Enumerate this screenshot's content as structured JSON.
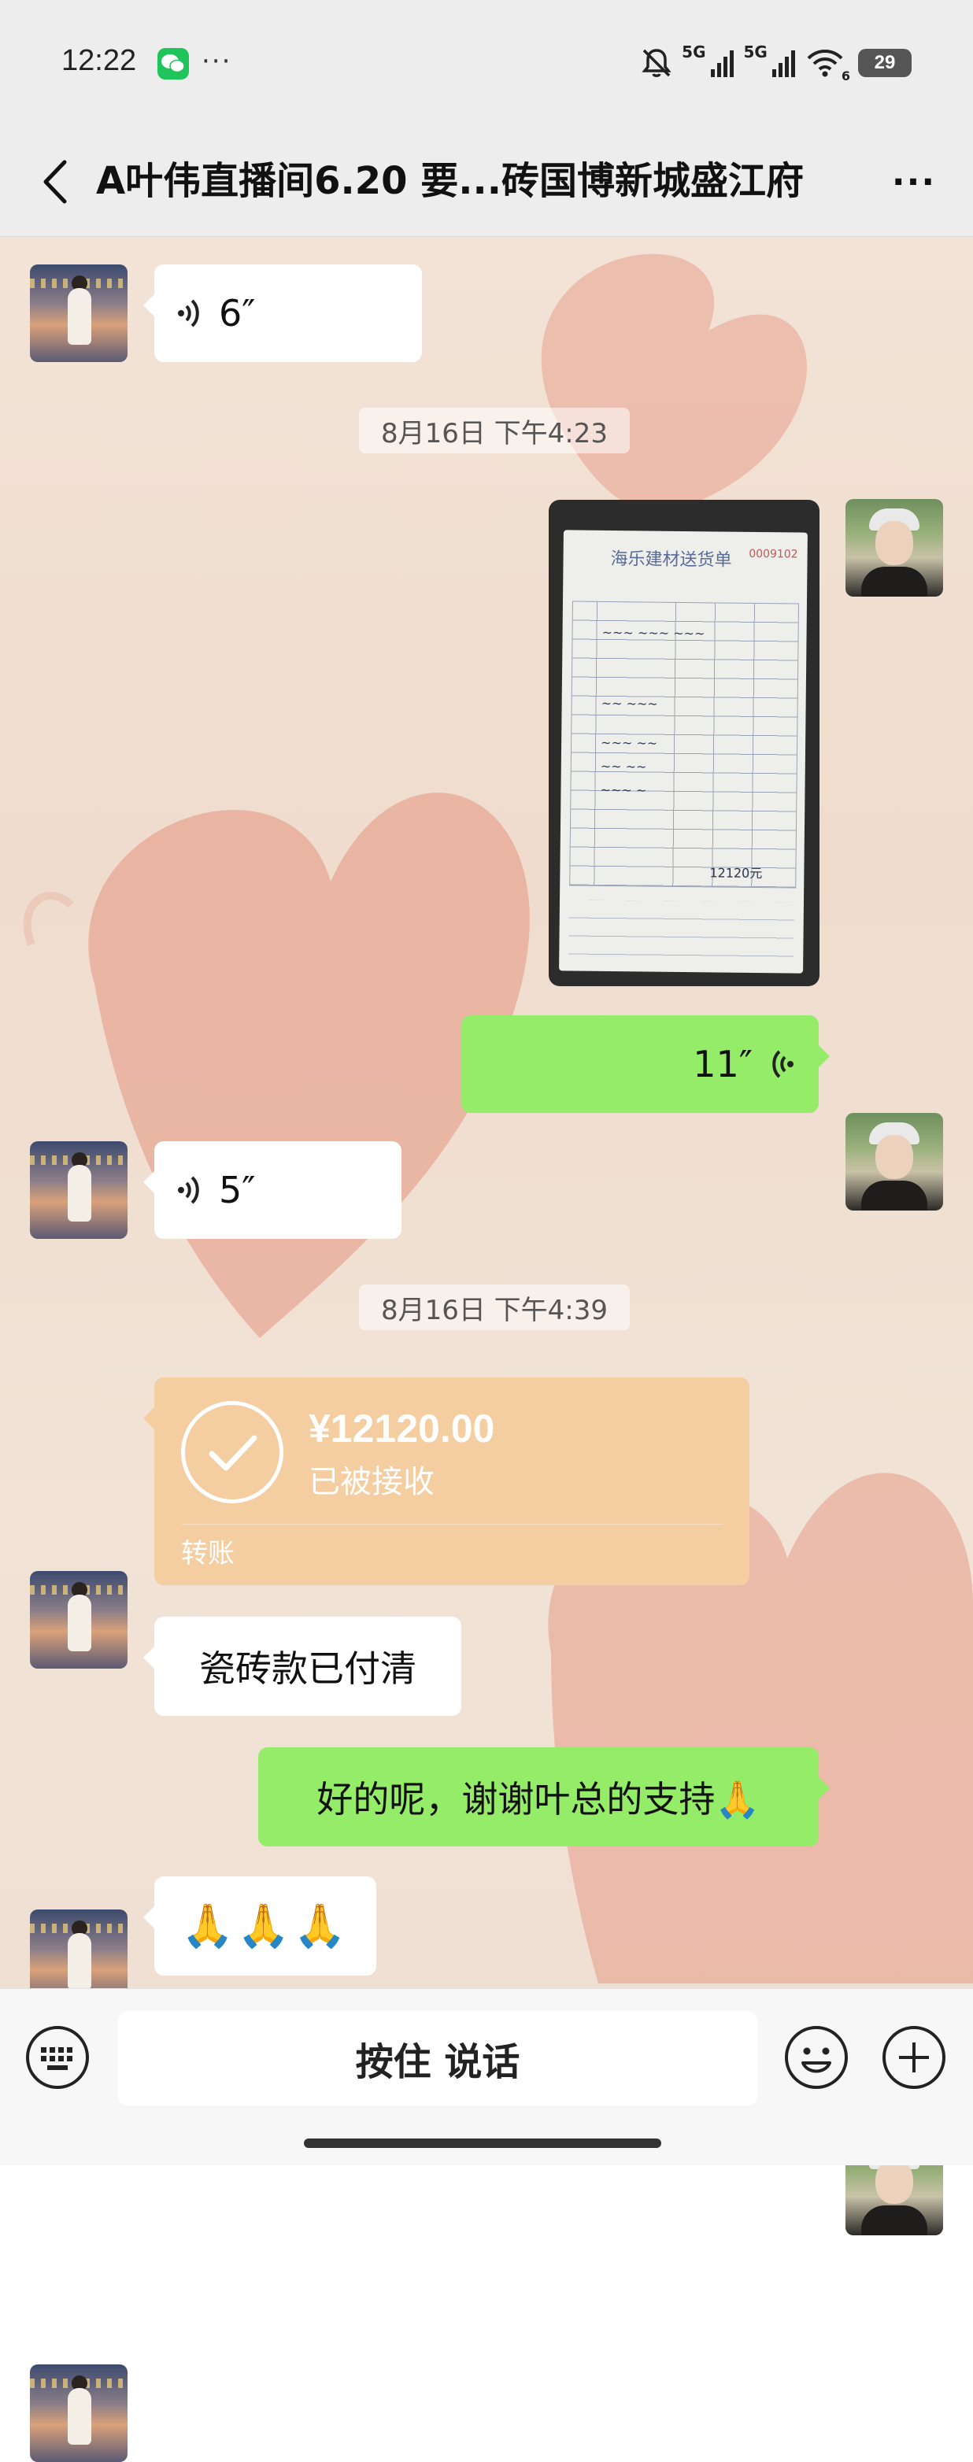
{
  "status_bar": {
    "time": "12:22",
    "more": "···",
    "signal_label_1": "5G",
    "signal_label_2": "5G",
    "wifi_sub": "6",
    "battery": "29"
  },
  "header": {
    "title": "A叶伟直播间6.20 要...砖国博新城盛江府",
    "more": "···"
  },
  "timestamps": {
    "t1": "8月16日 下午4:23",
    "t2": "8月16日 下午4:39"
  },
  "messages": {
    "voice_1": "6″",
    "voice_2": "11″",
    "voice_3": "5″",
    "text_paid": "瓷砖款已付清",
    "text_thanks": "好的呢，谢谢叶总的支持🙏",
    "text_emoji": "🙏🙏🙏"
  },
  "receipt": {
    "heading": "海乐建材送货单",
    "number": "0009102",
    "total": "12120元"
  },
  "transfer": {
    "amount": "¥12120.00",
    "status": "已被接收",
    "kind": "转账",
    "color": "#f4cda0"
  },
  "input_bar": {
    "talk_label": "按住 说话"
  },
  "colors": {
    "bubble_green": "#95ec69",
    "bubble_white": "#ffffff",
    "header_bg": "#ededed"
  }
}
